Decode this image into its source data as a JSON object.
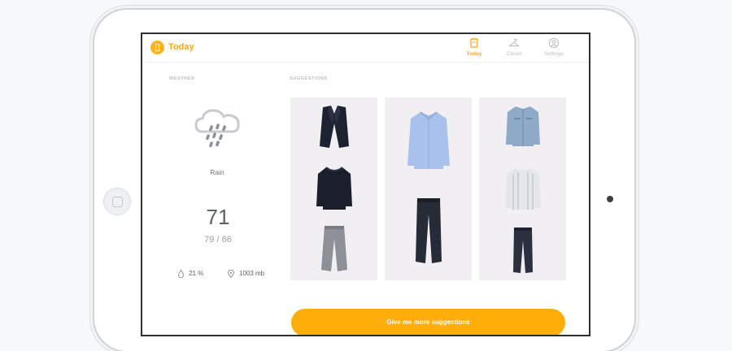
{
  "app": {
    "title": "Today",
    "accent_color": "#f5a917",
    "logo_icon": "app-logo-icon"
  },
  "nav": {
    "tabs": [
      {
        "label": "Today",
        "icon": "calendar-icon",
        "active": true
      },
      {
        "label": "Closet",
        "icon": "hanger-icon",
        "active": false
      },
      {
        "label": "Settings",
        "icon": "user-circle-icon",
        "active": false
      }
    ]
  },
  "weather": {
    "section_label": "WEATHER",
    "icon": "rain-cloud-icon",
    "condition": "Rain",
    "temperature": "71",
    "temp_range": "79 / 66",
    "humidity": "21 %",
    "pressure": "1003 mb"
  },
  "suggestions": {
    "section_label": "SUGGESTIONS",
    "outfits": [
      {
        "items": [
          "dark-blazer",
          "dark-sweater",
          "grey-trousers"
        ]
      },
      {
        "items": [
          "light-blue-shirt",
          "dark-jeans"
        ]
      },
      {
        "items": [
          "denim-jacket",
          "striped-shirt",
          "dark-skinny-jeans"
        ]
      }
    ]
  },
  "actions": {
    "more_button_label": "Give me more suggestions",
    "button_color": "#ffad08"
  }
}
